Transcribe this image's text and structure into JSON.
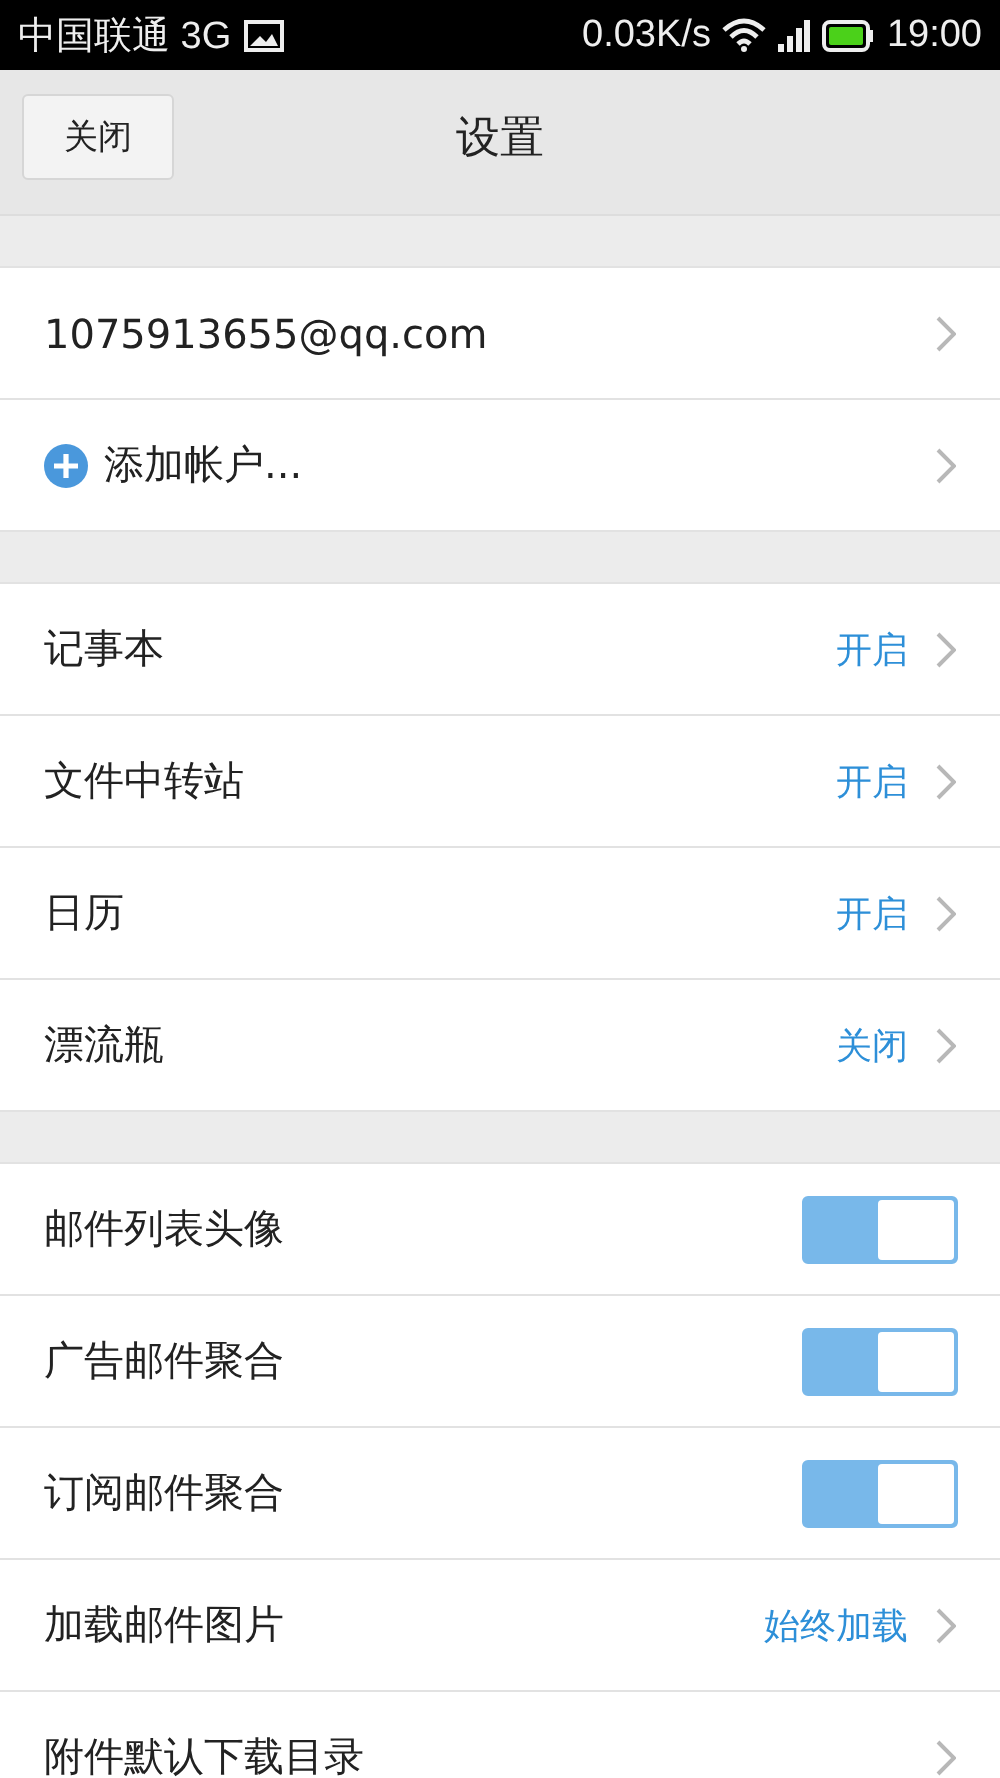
{
  "status_bar": {
    "carrier": "中国联通 3G",
    "speed": "0.03K/s",
    "time": "19:00"
  },
  "header": {
    "close_button": "关闭",
    "title": "设置"
  },
  "sections": [
    {
      "rows": [
        {
          "kind": "link",
          "label": "1075913655@qq.com"
        },
        {
          "kind": "add",
          "label": "添加帐户..."
        }
      ]
    },
    {
      "rows": [
        {
          "kind": "value",
          "label": "记事本",
          "value": "开启"
        },
        {
          "kind": "value",
          "label": "文件中转站",
          "value": "开启"
        },
        {
          "kind": "value",
          "label": "日历",
          "value": "开启"
        },
        {
          "kind": "value",
          "label": "漂流瓶",
          "value": "关闭"
        }
      ]
    },
    {
      "rows": [
        {
          "kind": "toggle",
          "label": "邮件列表头像",
          "on": true
        },
        {
          "kind": "toggle",
          "label": "广告邮件聚合",
          "on": true
        },
        {
          "kind": "toggle",
          "label": "订阅邮件聚合",
          "on": true
        },
        {
          "kind": "value",
          "label": "加载邮件图片",
          "value": "始终加载"
        },
        {
          "kind": "link",
          "label": "附件默认下载目录"
        }
      ]
    }
  ]
}
